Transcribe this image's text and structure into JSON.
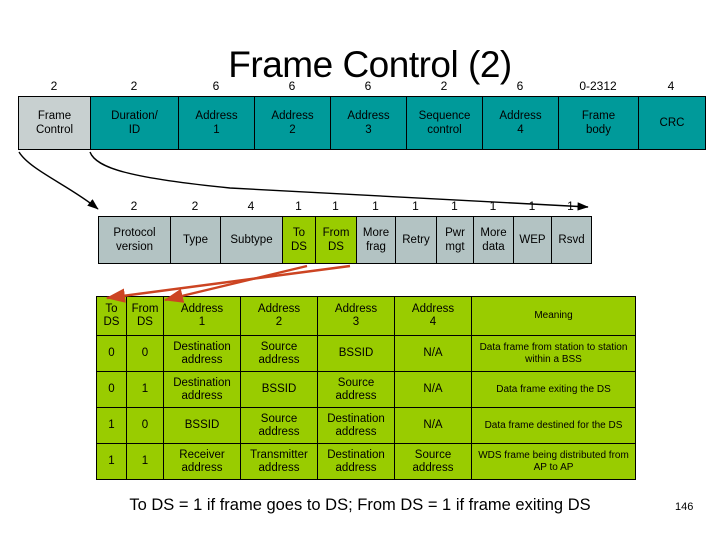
{
  "slide": {
    "title": "Frame Control (2)",
    "footer_note": "To DS = 1 if frame goes to DS;  From DS = 1 if frame exiting DS",
    "slide_number": "146",
    "colors": {
      "teal": "#009a9a",
      "grey": "#c8d0d0",
      "bit_grey": "#b3c3c3",
      "green": "#99cc00",
      "arrow_red": "#cc4422",
      "arrow_black": "#000000"
    }
  },
  "frame_row": {
    "size_label_unit": "bytes",
    "cells": [
      {
        "size": "2",
        "label": "Frame Control",
        "label_lines": [
          "Frame",
          "Control"
        ],
        "highlight": true
      },
      {
        "size": "2",
        "label": "Duration/ ID",
        "label_lines": [
          "Duration/",
          "ID"
        ],
        "highlight": false
      },
      {
        "size": "6",
        "label": "Address 1",
        "label_lines": [
          "Address",
          "1"
        ],
        "highlight": false
      },
      {
        "size": "6",
        "label": "Address 2",
        "label_lines": [
          "Address",
          "2"
        ],
        "highlight": false
      },
      {
        "size": "6",
        "label": "Address 3",
        "label_lines": [
          "Address",
          "3"
        ],
        "highlight": false
      },
      {
        "size": "2",
        "label": "Sequence control",
        "label_lines": [
          "Sequence",
          "control"
        ],
        "highlight": false
      },
      {
        "size": "6",
        "label": "Address 4",
        "label_lines": [
          "Address",
          "4"
        ],
        "highlight": false
      },
      {
        "size": "0-2312",
        "label": "Frame body",
        "label_lines": [
          "Frame",
          "body"
        ],
        "highlight": false
      },
      {
        "size": "4",
        "label": "CRC",
        "label_lines": [
          "CRC"
        ],
        "highlight": false
      }
    ]
  },
  "bit_row": {
    "size_label_unit": "bits",
    "cells": [
      {
        "size": "2",
        "label": "Protocol version",
        "label_lines": [
          "Protocol",
          "version"
        ],
        "highlight": false
      },
      {
        "size": "2",
        "label": "Type",
        "label_lines": [
          "Type"
        ],
        "highlight": false
      },
      {
        "size": "4",
        "label": "Subtype",
        "label_lines": [
          "Subtype"
        ],
        "highlight": false
      },
      {
        "size": "1",
        "label": "To DS",
        "label_lines": [
          "To",
          "DS"
        ],
        "highlight": true
      },
      {
        "size": "1",
        "label": "From DS",
        "label_lines": [
          "From",
          "DS"
        ],
        "highlight": true
      },
      {
        "size": "1",
        "label": "More frag",
        "label_lines": [
          "More",
          "frag"
        ],
        "highlight": false
      },
      {
        "size": "1",
        "label": "Retry",
        "label_lines": [
          "Retry"
        ],
        "highlight": false
      },
      {
        "size": "1",
        "label": "Pwr mgt",
        "label_lines": [
          "Pwr",
          "mgt"
        ],
        "highlight": false
      },
      {
        "size": "1",
        "label": "More data",
        "label_lines": [
          "More",
          "data"
        ],
        "highlight": false
      },
      {
        "size": "1",
        "label": "WEP",
        "label_lines": [
          "WEP"
        ],
        "highlight": false
      },
      {
        "size": "1",
        "label": "Rsvd",
        "label_lines": [
          "Rsvd"
        ],
        "highlight": false
      }
    ]
  },
  "address_table": {
    "headers": [
      "To DS",
      "From DS",
      "Address 1",
      "Address 2",
      "Address 3",
      "Address 4",
      "Meaning"
    ],
    "header_lines": [
      [
        "To",
        "DS"
      ],
      [
        "From",
        "DS"
      ],
      [
        "Address",
        "1"
      ],
      [
        "Address",
        "2"
      ],
      [
        "Address",
        "3"
      ],
      [
        "Address",
        "4"
      ],
      [
        "Meaning"
      ]
    ],
    "rows": [
      {
        "to_ds": "0",
        "from_ds": "0",
        "address1": "Destination address",
        "address2": "Source address",
        "address3": "BSSID",
        "address4": "N/A",
        "meaning": "Data frame from station to station within a BSS"
      },
      {
        "to_ds": "0",
        "from_ds": "1",
        "address1": "Destination address",
        "address2": "BSSID",
        "address3": "Source address",
        "address4": "N/A",
        "meaning": "Data frame exiting the DS"
      },
      {
        "to_ds": "1",
        "from_ds": "0",
        "address1": "BSSID",
        "address2": "Source address",
        "address3": "Destination address",
        "address4": "N/A",
        "meaning": "Data frame destined for the DS"
      },
      {
        "to_ds": "1",
        "from_ds": "1",
        "address1": "Receiver address",
        "address2": "Transmitter address",
        "address3": "Destination address",
        "address4": "Source address",
        "meaning": "WDS frame being distributed from AP to AP"
      }
    ]
  }
}
